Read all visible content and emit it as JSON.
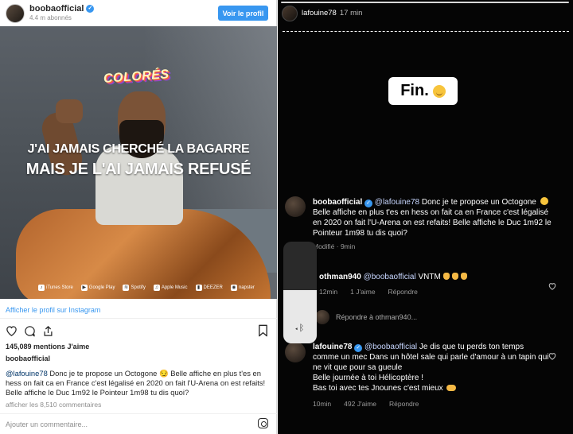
{
  "instagram_post": {
    "username": "booba​official",
    "followers": "4.4 m abonnés",
    "follow_button": "Voir le profil",
    "image": {
      "colores_label": "COLORÉS",
      "caption_line1": "J'AI JAMAIS CHERCHÉ LA BAGARRE",
      "caption_line2": "MAIS JE L'AI JAMAIS REFUSÉ",
      "stores": [
        "iTunes Store",
        "Google Play",
        "Spotify",
        "Apple Music",
        "DEEZER",
        "napster"
      ]
    },
    "view_profile_link": "Afficher le profil sur Instagram",
    "likes": "145,089 mentions J'aime",
    "owner": "boobaofficial",
    "comment": {
      "mention": "@lafouine78",
      "text": " Donc je te propose un Octogone 😏 Belle affiche en plus t'es en hess on fait ca en France c'est légalisé en 2020 on fait l'U-Arena on est refaits! Belle affiche le Duc 1m92 le Pointeur 1m98 tu dis quoi?"
    },
    "view_all_comments": "afficher les 8,510 commentaires",
    "add_comment_placeholder": "Ajouter un commentaire..."
  },
  "story": {
    "username": "lafouine78",
    "time": "17 min",
    "sticker_text": "Fin.",
    "volume_level": 0.52,
    "comments": [
      {
        "user": "boobaofficial",
        "mention": "@lafouine78",
        "text_a": " Donc je te propose un Octogone ",
        "text_b": " Belle affiche en plus t'es en hess on fait ca en France c'est légalisé en 2020 on fait l'U-Arena on est refaits! Belle affiche le Duc 1m92 le Pointeur 1m98 tu dis quoi?",
        "meta_time": "Modifié · 9min"
      },
      {
        "user": "othman940",
        "mention": "@boobaofficial",
        "text": " VNTM",
        "meta_time": "12min",
        "meta_likes": "1 J'aime",
        "meta_reply": "Répondre"
      },
      {
        "reply_text": "Répondre à othman940..."
      },
      {
        "user": "lafouine78",
        "mention": "@boobaofficial",
        "text_a": " Je dis que tu perds ton temps comme un mec Dans un hôtel sale qui parle d'amour à un tapin qui ne vit que pour sa gueule",
        "text_b": "Belle journée à toi Hélicoptère !",
        "text_c": "Bas toi avec tes Jnounes c'est mieux",
        "meta_time": "10min",
        "meta_likes": "492 J'aime",
        "meta_reply": "Répondre"
      }
    ]
  }
}
